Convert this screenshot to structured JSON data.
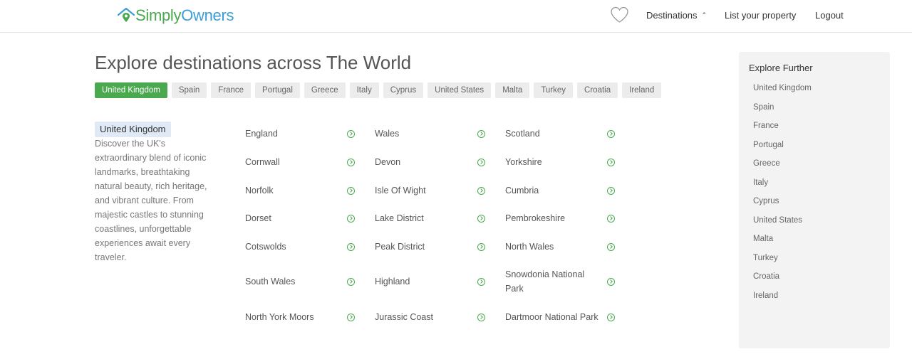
{
  "header": {
    "logo_simply": "Simply",
    "logo_owners": "Owners",
    "nav": {
      "destinations": "Destinations",
      "list_property": "List your property",
      "logout": "Logout"
    }
  },
  "page_title": "Explore destinations across The World",
  "tabs": [
    {
      "label": "United Kingdom",
      "active": true
    },
    {
      "label": "Spain"
    },
    {
      "label": "France"
    },
    {
      "label": "Portugal"
    },
    {
      "label": "Greece"
    },
    {
      "label": "Italy"
    },
    {
      "label": "Cyprus"
    },
    {
      "label": "United States"
    },
    {
      "label": "Malta"
    },
    {
      "label": "Turkey"
    },
    {
      "label": "Croatia"
    },
    {
      "label": "Ireland"
    }
  ],
  "region": {
    "name": "United Kingdom",
    "description": "Discover the UK's extraordinary blend of iconic landmarks, breathtaking natural beauty, rich heritage, and vibrant culture. From majestic castles to stunning coastlines, unforgettable experiences await every traveler."
  },
  "destinations": [
    [
      "England",
      "Wales",
      "Scotland"
    ],
    [
      "Cornwall",
      "Devon",
      "Yorkshire"
    ],
    [
      "Norfolk",
      "Isle Of Wight",
      "Cumbria"
    ],
    [
      "Dorset",
      "Lake District",
      "Pembrokeshire"
    ],
    [
      "Cotswolds",
      "Peak District",
      "North Wales"
    ],
    [
      "South Wales",
      "Highland",
      "Snowdonia National Park"
    ],
    [
      "North York Moors",
      "Jurassic Coast",
      "Dartmoor National Park"
    ]
  ],
  "sidebar": {
    "title": "Explore Further",
    "items": [
      "United Kingdom",
      "Spain",
      "France",
      "Portugal",
      "Greece",
      "Italy",
      "Cyprus",
      "United States",
      "Malta",
      "Turkey",
      "Croatia",
      "Ireland"
    ]
  },
  "colors": {
    "accent_green": "#4aa94e",
    "accent_blue": "#3a9fd8"
  }
}
